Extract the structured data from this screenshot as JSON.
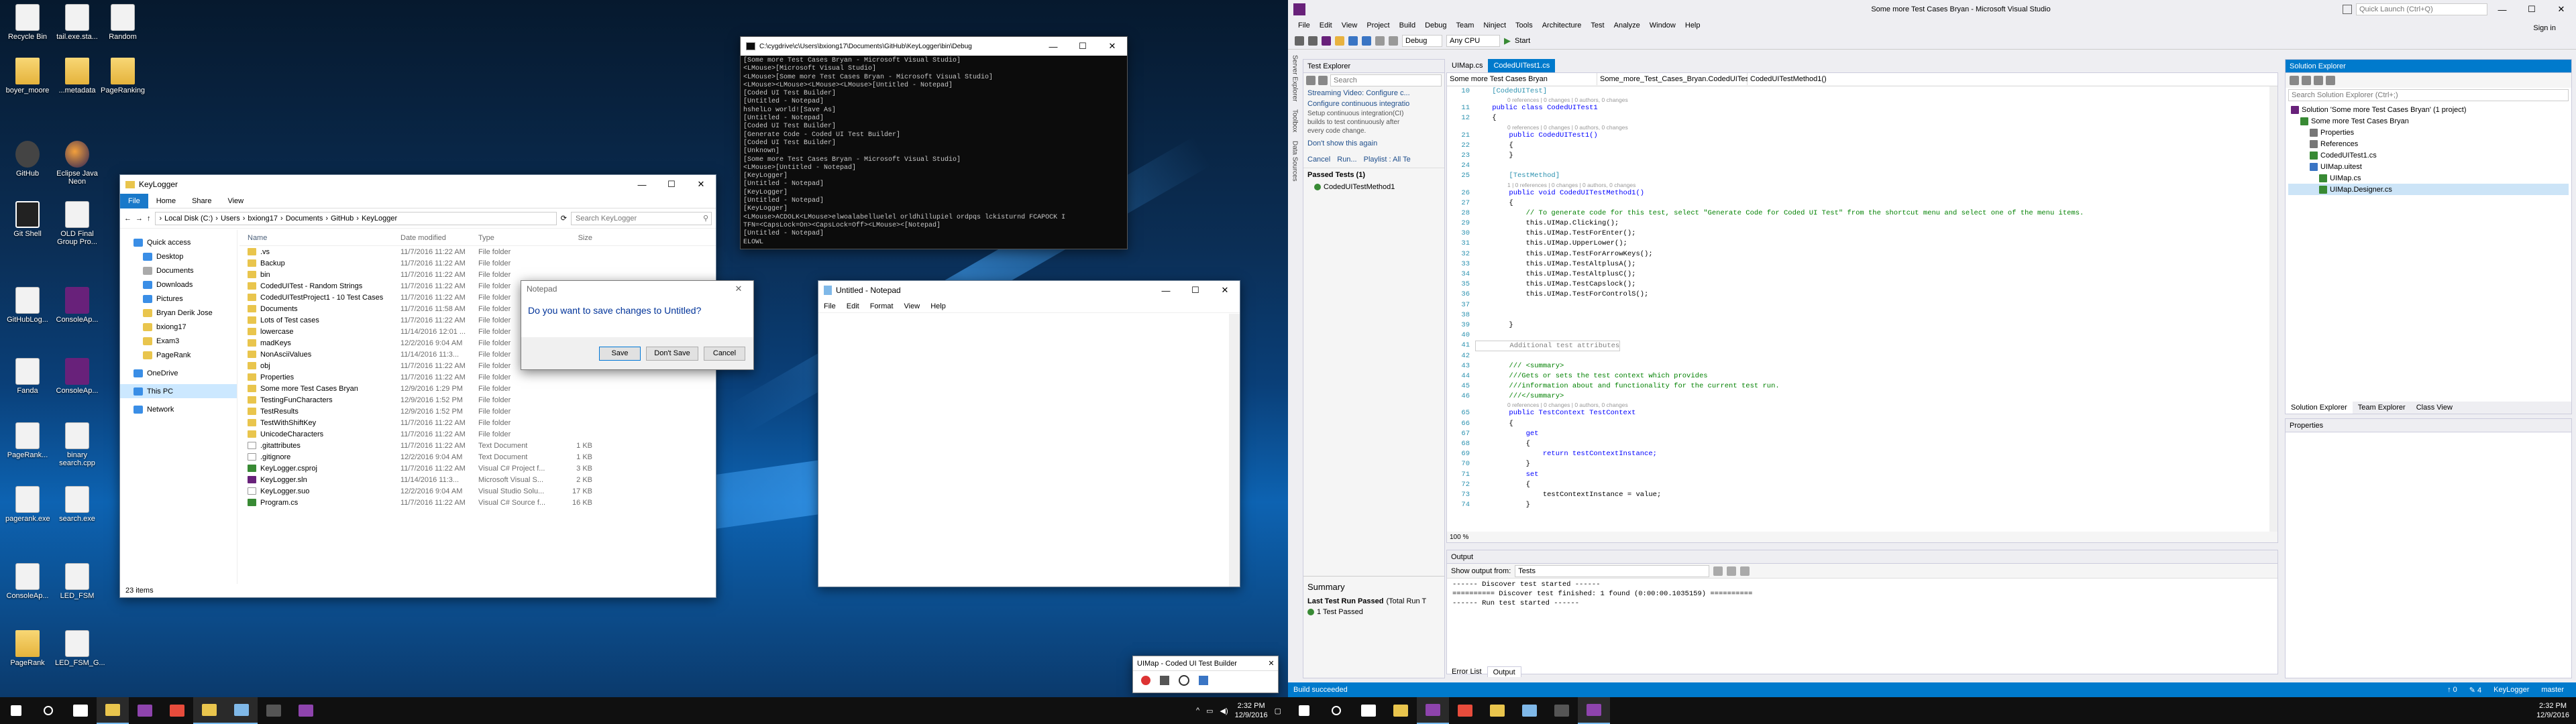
{
  "desktop": {
    "icons": [
      {
        "label": "Recycle Bin",
        "icon": "recycle-bin"
      },
      {
        "label": "tail.exe.sta...",
        "icon": "document"
      },
      {
        "label": "Random",
        "icon": "document"
      },
      {
        "label": "boyer_moore",
        "icon": "folder"
      },
      {
        "label": "...metadata",
        "icon": "folder"
      },
      {
        "label": "PageRanking",
        "icon": "folder"
      },
      {
        "label": "GitHub",
        "icon": "github"
      },
      {
        "label": "Eclipse Java Neon",
        "icon": "eclipse"
      },
      {
        "label": "Git Shell",
        "icon": "terminal"
      },
      {
        "label": "OLD Final Group Pro...",
        "icon": "document"
      },
      {
        "label": "GitHubLog...",
        "icon": "document"
      },
      {
        "label": "ConsoleAp...",
        "icon": "visual-studio"
      },
      {
        "label": "Fanda",
        "icon": "document"
      },
      {
        "label": "ConsoleAp...",
        "icon": "visual-studio"
      },
      {
        "label": "PageRank...",
        "icon": "document"
      },
      {
        "label": "binary search.cpp",
        "icon": "document"
      },
      {
        "label": "pagerank.exe",
        "icon": "document"
      },
      {
        "label": "search.exe",
        "icon": "document"
      },
      {
        "label": "ConsoleAp...",
        "icon": "document"
      },
      {
        "label": "LED_FSM",
        "icon": "document"
      },
      {
        "label": "PageRank",
        "icon": "folder"
      },
      {
        "label": "LED_FSM_G...",
        "icon": "document"
      }
    ]
  },
  "explorer": {
    "title": "KeyLogger",
    "ribbon_tabs": [
      "File",
      "Home",
      "Share",
      "View"
    ],
    "address": [
      "Local Disk (C:)",
      "Users",
      "bxiong17",
      "Documents",
      "GitHub",
      "KeyLogger"
    ],
    "search_placeholder": "Search KeyLogger",
    "nav": [
      {
        "label": "Quick access",
        "icon": "star"
      },
      {
        "label": "Desktop",
        "icon": "desktop"
      },
      {
        "label": "Documents",
        "icon": "documents"
      },
      {
        "label": "Downloads",
        "icon": "downloads"
      },
      {
        "label": "Pictures",
        "icon": "pictures"
      },
      {
        "label": "Bryan Derik Jose",
        "icon": "folder"
      },
      {
        "label": "bxiong17",
        "icon": "folder"
      },
      {
        "label": "Exam3",
        "icon": "folder"
      },
      {
        "label": "PageRank",
        "icon": "folder"
      },
      {
        "label": "OneDrive",
        "icon": "cloud"
      },
      {
        "label": "This PC",
        "icon": "computer"
      },
      {
        "label": "Network",
        "icon": "network"
      }
    ],
    "columns": [
      "Name",
      "Date modified",
      "Type",
      "Size"
    ],
    "files": [
      {
        "name": ".vs",
        "date": "11/7/2016 11:22 AM",
        "type": "File folder",
        "size": "",
        "kind": "folder"
      },
      {
        "name": "Backup",
        "date": "11/7/2016 11:22 AM",
        "type": "File folder",
        "size": "",
        "kind": "folder"
      },
      {
        "name": "bin",
        "date": "11/7/2016 11:22 AM",
        "type": "File folder",
        "size": "",
        "kind": "folder"
      },
      {
        "name": "CodedUITest - Random Strings",
        "date": "11/7/2016 11:22 AM",
        "type": "File folder",
        "size": "",
        "kind": "folder"
      },
      {
        "name": "CodedUITestProject1 - 10 Test Cases",
        "date": "11/7/2016 11:22 AM",
        "type": "File folder",
        "size": "",
        "kind": "folder"
      },
      {
        "name": "Documents",
        "date": "11/7/2016 11:58 AM",
        "type": "File folder",
        "size": "",
        "kind": "folder"
      },
      {
        "name": "Lots of Test cases",
        "date": "11/7/2016 11:22 AM",
        "type": "File folder",
        "size": "",
        "kind": "folder"
      },
      {
        "name": "lowercase",
        "date": "11/14/2016 12:01 ...",
        "type": "File folder",
        "size": "",
        "kind": "folder"
      },
      {
        "name": "madKeys",
        "date": "12/2/2016 9:04 AM",
        "type": "File folder",
        "size": "",
        "kind": "folder"
      },
      {
        "name": "NonAsciiValues",
        "date": "11/14/2016 11:3...",
        "type": "File folder",
        "size": "",
        "kind": "folder"
      },
      {
        "name": "obj",
        "date": "11/7/2016 11:22 AM",
        "type": "File folder",
        "size": "",
        "kind": "folder"
      },
      {
        "name": "Properties",
        "date": "11/7/2016 11:22 AM",
        "type": "File folder",
        "size": "",
        "kind": "folder"
      },
      {
        "name": "Some more Test Cases Bryan",
        "date": "12/9/2016 1:29 PM",
        "type": "File folder",
        "size": "",
        "kind": "folder"
      },
      {
        "name": "TestingFunCharacters",
        "date": "12/9/2016 1:52 PM",
        "type": "File folder",
        "size": "",
        "kind": "folder"
      },
      {
        "name": "TestResults",
        "date": "12/9/2016 1:52 PM",
        "type": "File folder",
        "size": "",
        "kind": "folder"
      },
      {
        "name": "TestWithShiftKey",
        "date": "11/7/2016 11:22 AM",
        "type": "File folder",
        "size": "",
        "kind": "folder"
      },
      {
        "name": "UnicodeCharacters",
        "date": "11/7/2016 11:22 AM",
        "type": "File folder",
        "size": "",
        "kind": "folder"
      },
      {
        "name": ".gitattributes",
        "date": "11/7/2016 11:22 AM",
        "type": "Text Document",
        "size": "1 KB",
        "kind": "file"
      },
      {
        "name": ".gitignore",
        "date": "12/2/2016 9:04 AM",
        "type": "Text Document",
        "size": "1 KB",
        "kind": "file"
      },
      {
        "name": "KeyLogger.csproj",
        "date": "11/7/2016 11:22 AM",
        "type": "Visual C# Project f...",
        "size": "3 KB",
        "kind": "cs"
      },
      {
        "name": "KeyLogger.sln",
        "date": "11/14/2016 11:3...",
        "type": "Microsoft Visual S...",
        "size": "2 KB",
        "kind": "sln"
      },
      {
        "name": "KeyLogger.suo",
        "date": "12/2/2016 9:04 AM",
        "type": "Visual Studio Solu...",
        "size": "17 KB",
        "kind": "file"
      },
      {
        "name": "Program.cs",
        "date": "11/7/2016 11:22 AM",
        "type": "Visual C# Source f...",
        "size": "16 KB",
        "kind": "cs"
      }
    ],
    "status": "23 items"
  },
  "cmd": {
    "title": "C:\\cygdrive\\c\\Users\\bxiong17\\Documents\\GitHub\\KeyLogger\\bin\\Debug",
    "lines": [
      "[Some more Test Cases Bryan - Microsoft Visual Studio]",
      "<LMouse>[Microsoft Visual Studio]",
      "<LMouse>[Some more Test Cases Bryan - Microsoft Visual Studio]",
      "<LMouse><LMouse><LMouse><LMouse>[Untitled - Notepad]",
      "[Coded UI Test Builder]",
      "[Untitled - Notepad]",
      "hshelLo world![Save As]",
      "[Untitled - Notepad]",
      "[Coded UI Test Builder]",
      "[Generate Code - Coded UI Test Builder]",
      "[Coded UI Test Builder]",
      "[Unknown]",
      "[Some more Test Cases Bryan - Microsoft Visual Studio]",
      "<LMouse>[Untitled - Notepad]",
      "[KeyLogger]",
      "[Untitled - Notepad]",
      "[KeyLogger]",
      "[Untitled - Notepad]",
      "[KeyLogger]",
      "<LMouse>ACDOLK<LMouse>elwoalabelluelel orldhillupiel ordpqs lckisturnd FCAPOCK I",
      "TFN=<CapsLock=On><CapsLock=Off><LMouse><[Notepad]",
      "[Untitled - Notepad]",
      "ELOWL"
    ]
  },
  "notepad": {
    "title": "Untitled - Notepad",
    "menu": [
      "File",
      "Edit",
      "Format",
      "View",
      "Help"
    ]
  },
  "dialog": {
    "title": "Notepad",
    "message": "Do you want to save changes to Untitled?",
    "buttons": [
      "Save",
      "Don't Save",
      "Cancel"
    ]
  },
  "coded_ui": {
    "title": "UIMap - Coded UI Test Builder"
  },
  "taskbar_left": {
    "clock_time": "2:32 PM",
    "clock_date": "12/9/2016",
    "apps": [
      "start",
      "search",
      "task-view",
      "explorer",
      "visual-studio",
      "chrome",
      "explorer",
      "notepad",
      "terminal",
      "visual-studio"
    ]
  },
  "vs": {
    "title": "Some more Test Cases Bryan - Microsoft Visual Studio",
    "quick_launch": "Quick Launch (Ctrl+Q)",
    "sign_in": "Sign in",
    "menu": [
      "File",
      "Edit",
      "View",
      "Project",
      "Build",
      "Debug",
      "Team",
      "Ninject",
      "Tools",
      "Architecture",
      "Test",
      "Analyze",
      "Window",
      "Help"
    ],
    "config": "Debug",
    "platform": "Any CPU",
    "start": "Start",
    "side_tabs": [
      "Server Explorer",
      "Toolbox",
      "Data Sources"
    ],
    "test_explorer": {
      "title": "Test Explorer",
      "search": "Search",
      "streaming": "Streaming Video: Configure c...",
      "ci_link": "Configure continuous integratio",
      "ci_text": [
        "Setup continuous integration(CI)",
        "builds to test continuously after",
        "every code change."
      ],
      "dont_show": "Don't show this again",
      "actions": [
        "Cancel",
        "Run...",
        "Playlist : All Te"
      ],
      "passed": "Passed Tests (1)",
      "test_name": "CodedUITestMethod1",
      "summary_title": "Summary",
      "last_run": "Last Test Run Passed",
      "last_run_time": "(Total Run T",
      "passed_count": "1 Test Passed"
    },
    "tabs": [
      "UIMap.cs",
      "CodedUITest1.cs"
    ],
    "nav_combos": [
      "Some more Test Cases Bryan",
      "Some_more_Test_Cases_Bryan.CodedUITest1",
      "CodedUITestMethod1()"
    ],
    "code": [
      {
        "n": "10",
        "t": "    [CodedUITest]",
        "lens": ""
      },
      {
        "n": "",
        "t": "",
        "lens": "0 references | 0 changes | 0 authors, 0 changes"
      },
      {
        "n": "11",
        "t": "    public class CodedUITest1",
        "lens": ""
      },
      {
        "n": "12",
        "t": "    {",
        "lens": ""
      },
      {
        "n": "",
        "t": "",
        "lens": "0 references | 0 changes | 0 authors, 0 changes"
      },
      {
        "n": "21",
        "t": "        public CodedUITest1()",
        "lens": ""
      },
      {
        "n": "22",
        "t": "        {",
        "lens": ""
      },
      {
        "n": "23",
        "t": "        }",
        "lens": ""
      },
      {
        "n": "24",
        "t": "",
        "lens": ""
      },
      {
        "n": "25",
        "t": "        [TestMethod]",
        "lens": ""
      },
      {
        "n": "",
        "t": "",
        "lens": "1 | 0 references | 0 changes | 0 authors, 0 changes"
      },
      {
        "n": "26",
        "t": "        public void CodedUITestMethod1()",
        "lens": ""
      },
      {
        "n": "27",
        "t": "        {",
        "lens": ""
      },
      {
        "n": "28",
        "t": "            // To generate code for this test, select \"Generate Code for Coded UI Test\" from the shortcut menu and select one of the menu items.",
        "lens": ""
      },
      {
        "n": "29",
        "t": "            this.UIMap.Clicking();",
        "lens": ""
      },
      {
        "n": "30",
        "t": "            this.UIMap.TestForEnter();",
        "lens": ""
      },
      {
        "n": "31",
        "t": "            this.UIMap.UpperLower();",
        "lens": ""
      },
      {
        "n": "32",
        "t": "            this.UIMap.TestForArrowKeys();",
        "lens": ""
      },
      {
        "n": "33",
        "t": "            this.UIMap.TestAltplusA();",
        "lens": ""
      },
      {
        "n": "34",
        "t": "            this.UIMap.TestAltplusC();",
        "lens": ""
      },
      {
        "n": "35",
        "t": "            this.UIMap.TestCapslock();",
        "lens": ""
      },
      {
        "n": "36",
        "t": "            this.UIMap.TestForControlS();",
        "lens": ""
      },
      {
        "n": "37",
        "t": "",
        "lens": ""
      },
      {
        "n": "38",
        "t": "",
        "lens": ""
      },
      {
        "n": "39",
        "t": "        }",
        "lens": ""
      },
      {
        "n": "40",
        "t": "",
        "lens": ""
      },
      {
        "n": "41",
        "t": "        Additional test attributes",
        "lens": ""
      },
      {
        "n": "42",
        "t": "",
        "lens": ""
      },
      {
        "n": "43",
        "t": "        /// <summary>",
        "lens": ""
      },
      {
        "n": "44",
        "t": "        ///Gets or sets the test context which provides",
        "lens": ""
      },
      {
        "n": "45",
        "t": "        ///information about and functionality for the current test run.",
        "lens": ""
      },
      {
        "n": "46",
        "t": "        ///</summary>",
        "lens": ""
      },
      {
        "n": "",
        "t": "",
        "lens": "0 references | 0 changes | 0 authors, 0 changes"
      },
      {
        "n": "65",
        "t": "        public TestContext TestContext",
        "lens": ""
      },
      {
        "n": "66",
        "t": "        {",
        "lens": ""
      },
      {
        "n": "67",
        "t": "            get",
        "lens": ""
      },
      {
        "n": "68",
        "t": "            {",
        "lens": ""
      },
      {
        "n": "69",
        "t": "                return testContextInstance;",
        "lens": ""
      },
      {
        "n": "70",
        "t": "            }",
        "lens": ""
      },
      {
        "n": "71",
        "t": "            set",
        "lens": ""
      },
      {
        "n": "72",
        "t": "            {",
        "lens": ""
      },
      {
        "n": "73",
        "t": "                testContextInstance = value;",
        "lens": ""
      },
      {
        "n": "74",
        "t": "            }",
        "lens": ""
      }
    ],
    "zoom": "100 %",
    "output": {
      "title": "Output",
      "show_from_label": "Show output from:",
      "show_from": "Tests",
      "lines": [
        "------ Discover test started ------",
        "========== Discover test finished: 1 found (0:00:00.1035159) ==========",
        "------ Run test started ------"
      ],
      "tabs": [
        "Error List",
        "Output"
      ]
    },
    "solution_explorer": {
      "title": "Solution Explorer",
      "search": "Search Solution Explorer (Ctrl+;)",
      "items": [
        {
          "label": "Solution 'Some more Test Cases Bryan' (1 project)",
          "indent": 0,
          "icon": "solution"
        },
        {
          "label": "Some more Test Cases Bryan",
          "indent": 1,
          "icon": "csproj"
        },
        {
          "label": "Properties",
          "indent": 2,
          "icon": "wrench"
        },
        {
          "label": "References",
          "indent": 2,
          "icon": "references"
        },
        {
          "label": "CodedUITest1.cs",
          "indent": 2,
          "icon": "cs"
        },
        {
          "label": "UIMap.uitest",
          "indent": 2,
          "icon": "uitest"
        },
        {
          "label": "UIMap.cs",
          "indent": 3,
          "icon": "cs"
        },
        {
          "label": "UIMap.Designer.cs",
          "indent": 3,
          "icon": "cs"
        }
      ],
      "tabs": [
        "Solution Explorer",
        "Team Explorer",
        "Class View"
      ]
    },
    "properties_title": "Properties",
    "status": "Build succeeded",
    "status_right": [
      "↑ 0",
      "✎ 4",
      "KeyLogger",
      "master"
    ]
  },
  "taskbar_right": {
    "clock_time": "2:32 PM",
    "clock_date": "12/9/2016"
  }
}
